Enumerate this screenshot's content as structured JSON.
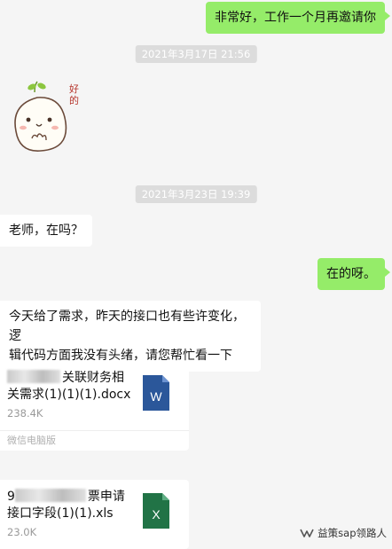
{
  "messages": {
    "m1": "非常好，工作一个月再邀请你",
    "ts1": "2021年3月17日 21:56",
    "sticker_text": "好的",
    "ts2": "2021年3月23日 19:39",
    "m2": "老师，在吗？",
    "m3": "在的呀。",
    "m4_line1": "今天给了需求，昨天的接口也有些许变化，逻",
    "m4_line2": "辑代码方面我没有头绪，请您帮忙看一下"
  },
  "files": [
    {
      "name_line1": "关联财务相",
      "name_line2": "关需求(1)(1)(1).docx",
      "size": "238.4K",
      "footer": "微信电脑版",
      "icon_letter": "W",
      "icon_color": "#2b579a",
      "type": "word"
    },
    {
      "name_prefix": "9",
      "name_line1": "票申请",
      "name_line2": "接口字段(1)(1).xls",
      "size": "23.0K",
      "icon_letter": "X",
      "icon_color": "#217346",
      "type": "excel"
    }
  ],
  "watermark": {
    "text": "益策sap领路人",
    "icon": "wechat-channel-icon"
  },
  "colors": {
    "my_bubble": "#95ec69",
    "their_bubble": "#ffffff",
    "background": "#f5f5f5",
    "timestamp_bg": "#dcdcdc"
  }
}
